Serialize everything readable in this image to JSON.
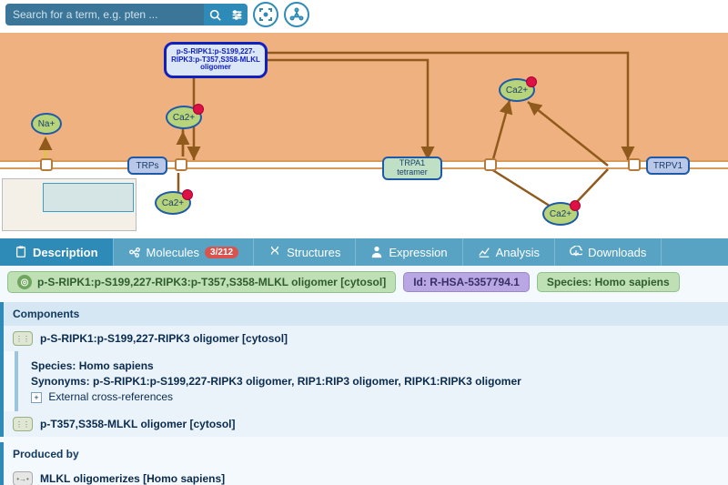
{
  "search": {
    "placeholder": "Search for a term, e.g. pten ..."
  },
  "diagram": {
    "selected": {
      "label": "p-S-RIPK1:p-S199,227-RIPK3:p-T357,S358-MLKL oligomer"
    },
    "nodes": {
      "na": {
        "label": "Na+"
      },
      "ca1": {
        "label": "Ca2+"
      },
      "ca2": {
        "label": "Ca2+"
      },
      "ca3": {
        "label": "Ca2+"
      },
      "ca4": {
        "label": "Ca2+"
      },
      "trps": {
        "label": "TRPs"
      },
      "trpa1": {
        "label": "TRPA1 tetramer"
      },
      "trpv1": {
        "label": "TRPV1"
      }
    }
  },
  "tabs": [
    {
      "label": "Description"
    },
    {
      "label": "Molecules",
      "badge": "3/212"
    },
    {
      "label": "Structures"
    },
    {
      "label": "Expression"
    },
    {
      "label": "Analysis"
    },
    {
      "label": "Downloads"
    }
  ],
  "chips": {
    "title": "p-S-RIPK1:p-S199,227-RIPK3:p-T357,S358-MLKL oligomer [cytosol]",
    "id": "Id: R-HSA-5357794.1",
    "species": "Species: Homo sapiens"
  },
  "components": {
    "header": "Components",
    "items": [
      {
        "name": "p-S-RIPK1:p-S199,227-RIPK3 oligomer [cytosol]",
        "species": "Species: Homo sapiens",
        "synonyms": "Synonyms: p-S-RIPK1:p-S199,227-RIPK3 oligomer, RIP1:RIP3 oligomer, RIPK1:RIPK3 oligomer",
        "xref": "External cross-references"
      },
      {
        "name": "p-T357,S358-MLKL oligomer [cytosol]"
      }
    ]
  },
  "producedBy": {
    "header": "Produced by",
    "items": [
      {
        "name": "MLKL oligomerizes [Homo sapiens]"
      }
    ]
  }
}
